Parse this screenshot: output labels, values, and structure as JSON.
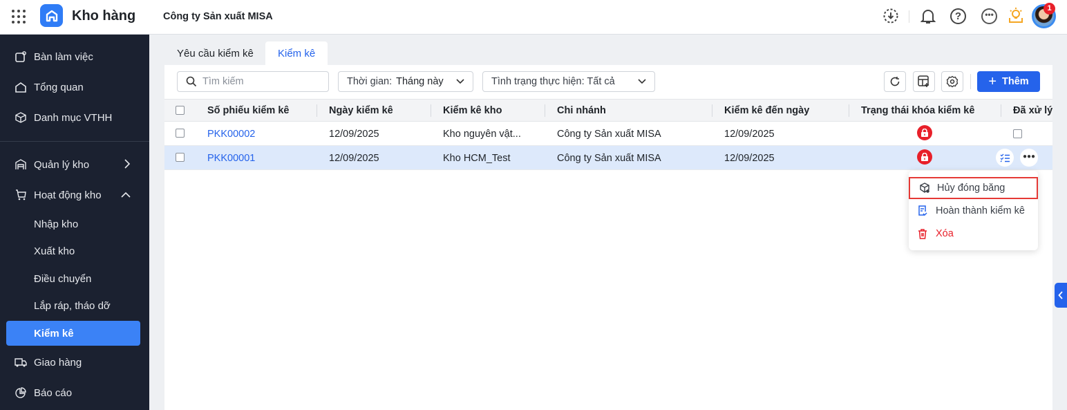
{
  "app": {
    "title": "Kho hàng",
    "company": "Công ty Sản xuất MISA",
    "notification_count": "1"
  },
  "sidebar": {
    "items": [
      {
        "label": "Bàn làm việc",
        "icon": "desk-icon"
      },
      {
        "label": "Tổng quan",
        "icon": "home-icon"
      },
      {
        "label": "Danh mục VTHH",
        "icon": "box-icon"
      },
      {
        "label": "Quản lý kho",
        "icon": "warehouse-icon"
      },
      {
        "label": "Hoạt động kho",
        "icon": "cart-icon"
      },
      {
        "label": "Nhập kho"
      },
      {
        "label": "Xuất kho"
      },
      {
        "label": "Điều chuyển"
      },
      {
        "label": "Lắp ráp, tháo dỡ"
      },
      {
        "label": "Kiểm kê"
      },
      {
        "label": "Giao hàng",
        "icon": "truck-icon"
      },
      {
        "label": "Báo cáo",
        "icon": "pie-chart-icon"
      }
    ]
  },
  "tabs": [
    {
      "label": "Yêu cầu kiểm kê"
    },
    {
      "label": "Kiểm kê"
    }
  ],
  "toolbar": {
    "search_placeholder": "Tìm kiếm",
    "time_label": "Thời gian:",
    "time_value": "Tháng này",
    "status_filter": "Tình trạng thực hiện: Tất cả",
    "add_label": "Thêm"
  },
  "table": {
    "columns": [
      "Số phiếu kiểm kê",
      "Ngày kiểm kê",
      "Kiểm kê kho",
      "Chi nhánh",
      "Kiểm kê đến ngày",
      "Trạng thái khóa kiểm kê",
      "Đã xử lý"
    ],
    "rows": [
      {
        "code": "PKK00002",
        "date": "12/09/2025",
        "warehouse": "Kho nguyên vật...",
        "branch": "Công ty Sản xuất MISA",
        "to_date": "12/09/2025",
        "locked": true
      },
      {
        "code": "PKK00001",
        "date": "12/09/2025",
        "warehouse": "Kho HCM_Test",
        "branch": "Công ty Sản xuất MISA",
        "to_date": "12/09/2025",
        "locked": true
      }
    ]
  },
  "context_menu": {
    "items": [
      {
        "label": "Hủy đóng băng"
      },
      {
        "label": "Hoàn thành kiểm kê"
      },
      {
        "label": "Xóa"
      }
    ]
  },
  "colors": {
    "accent": "#2563eb",
    "sidebar": "#1b2130",
    "danger": "#e8202a"
  }
}
